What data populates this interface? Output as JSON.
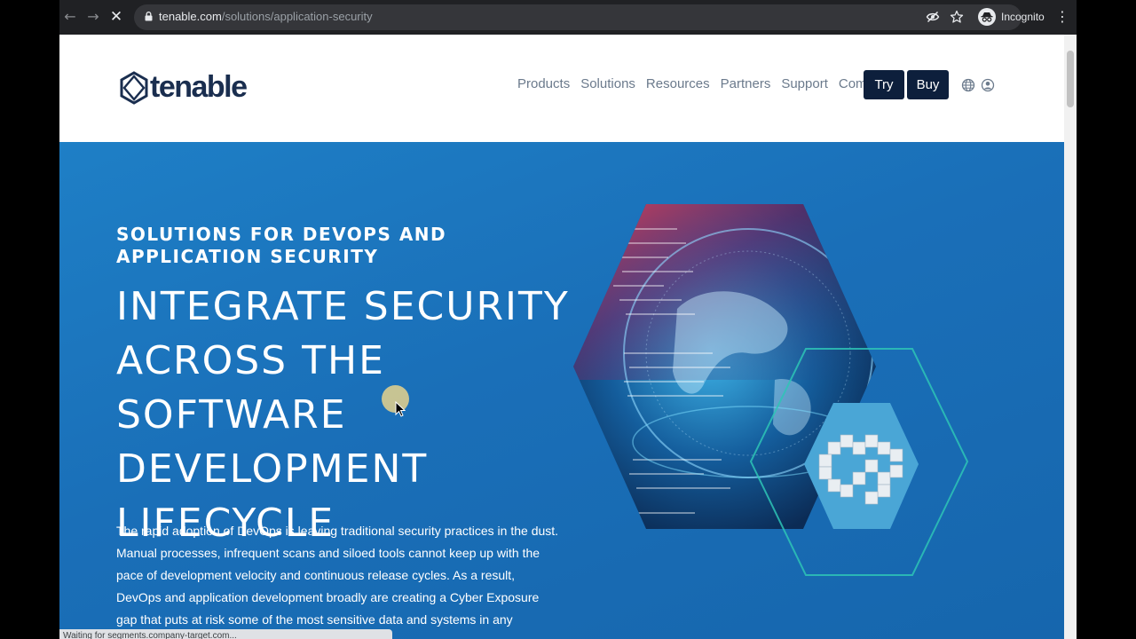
{
  "browser": {
    "url_domain": "tenable.com",
    "url_path": "/solutions/application-security",
    "profile_label": "Incognito",
    "status_text": "Waiting for segments.company-target.com..."
  },
  "header": {
    "logo_text": "tenable",
    "nav": [
      "Products",
      "Solutions",
      "Resources",
      "Partners",
      "Support",
      "Company"
    ],
    "try_label": "Try",
    "buy_label": "Buy"
  },
  "hero": {
    "eyebrow": "SOLUTIONS FOR DEVOPS AND APPLICATION SECURITY",
    "title": "INTEGRATE SECURITY ACROSS THE SOFTWARE DEVELOPMENT LIFECYCLE",
    "body": "The rapid adoption of DevOps is leaving traditional security practices in the dust. Manual processes, infrequent scans and siloed tools cannot keep up with the pace of development velocity and continuous release cycles. As a result, DevOps and application development broadly are creating a Cyber Exposure gap that puts at risk some of the most sensitive data and systems in any organization. Cybersecurity"
  },
  "colors": {
    "brand_navy": "#0d1f3c",
    "hero_blue": "#1a6fb8",
    "teal_outline": "#2ec4b6"
  },
  "icons": [
    "back-arrow",
    "forward-arrow",
    "stop-icon",
    "lock-icon",
    "eye-off-icon",
    "star-icon",
    "incognito-icon",
    "more-icon",
    "globe-icon",
    "user-icon"
  ]
}
